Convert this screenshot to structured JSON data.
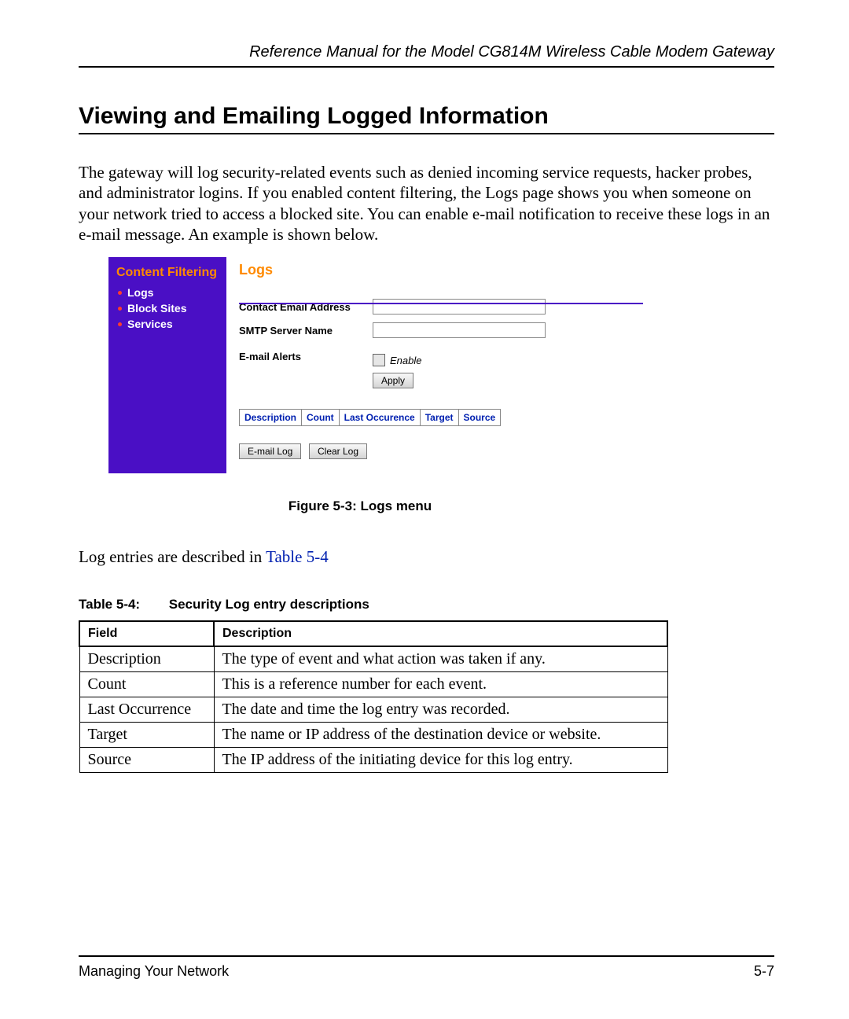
{
  "header": "Reference Manual for the Model CG814M Wireless Cable Modem Gateway",
  "section_title": "Viewing and Emailing Logged Information",
  "paragraph": "The gateway will log security-related events such as denied incoming service requests, hacker probes, and administrator logins. If you enabled content filtering, the Logs page shows you when someone on your network tried to access a blocked site. You can enable e-mail notification to receive these logs in an e-mail message. An example is shown below.",
  "ui": {
    "sidebar_title": "Content Filtering",
    "sidebar_items": [
      "Logs",
      "Block Sites",
      "Services"
    ],
    "panel_title": "Logs",
    "fields": {
      "contact_label": "Contact Email Address",
      "smtp_label": "SMTP Server Name",
      "alerts_label": "E-mail Alerts",
      "enable_label": "Enable"
    },
    "buttons": {
      "apply": "Apply",
      "email_log": "E-mail Log",
      "clear_log": "Clear Log"
    },
    "log_cols": [
      "Description",
      "Count",
      "Last Occurence",
      "Target",
      "Source"
    ]
  },
  "figure_caption": "Figure 5-3: Logs menu",
  "intro2_pre": "Log entries are described in ",
  "intro2_link": "Table 5-4",
  "table_caption_no": "Table 5-4:",
  "table_caption_title": "Security Log entry descriptions",
  "table_head": {
    "field": "Field",
    "desc": "Description"
  },
  "table_rows": [
    {
      "field": "Description",
      "desc": "The type of event and what action was taken if any."
    },
    {
      "field": "Count",
      "desc": "This is a reference number for each event."
    },
    {
      "field": "Last Occurrence",
      "desc": "The date and time the log entry was recorded."
    },
    {
      "field": "Target",
      "desc": "The name or IP address of the destination device or website."
    },
    {
      "field": "Source",
      "desc": "The IP address of the initiating device for this log entry."
    }
  ],
  "footer": {
    "left": "Managing Your Network",
    "right": "5-7"
  }
}
